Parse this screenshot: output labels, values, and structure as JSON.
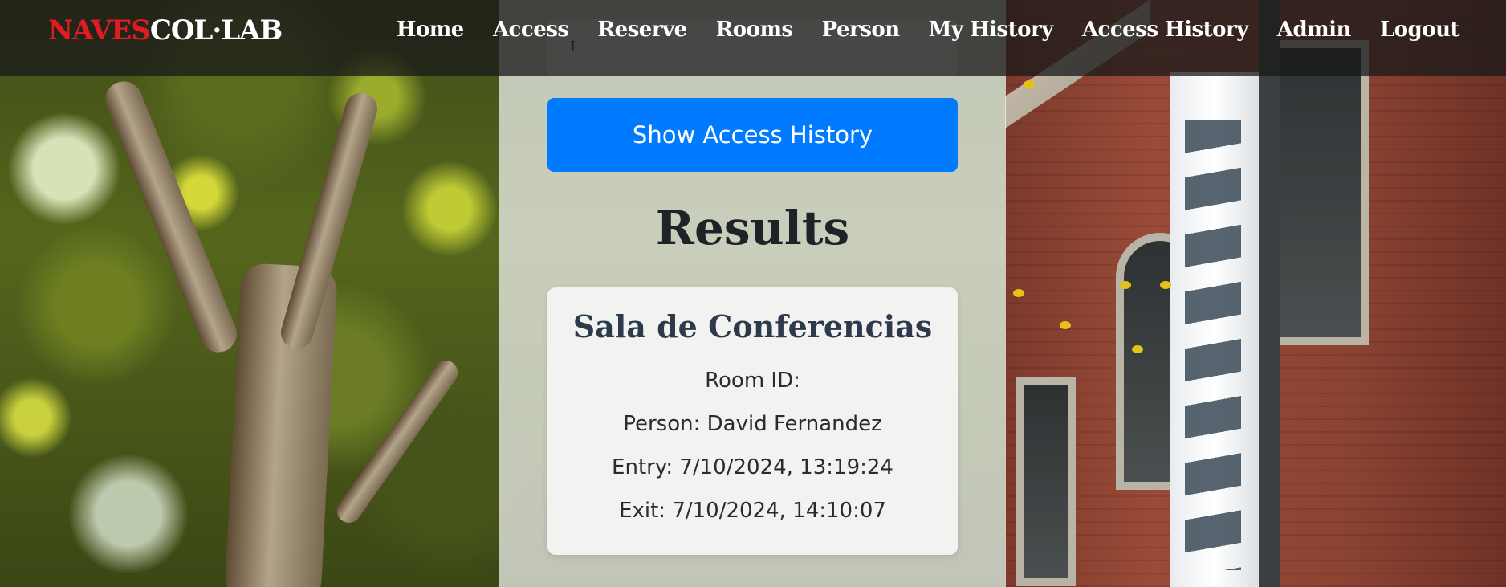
{
  "navbar": {
    "brand_red": "NAVES",
    "brand_white": "COL·LAB",
    "links": [
      "Home",
      "Access",
      "Reserve",
      "Rooms",
      "Person",
      "My History",
      "Access History",
      "Admin",
      "Logout"
    ]
  },
  "form": {
    "input_cursor": "I",
    "show_button_label": "Show Access History"
  },
  "results": {
    "title": "Results",
    "entries": [
      {
        "room_name": "Sala de Conferencias",
        "room_id_line": "Room ID:",
        "person_line": "Person: David Fernandez",
        "entry_line": "Entry: 7/10/2024, 13:19:24",
        "exit_line": "Exit: 7/10/2024, 14:10:07"
      }
    ]
  },
  "colors": {
    "brand_red": "#e21b23",
    "primary_button": "#007bff",
    "navbar_bg": "#191919"
  }
}
